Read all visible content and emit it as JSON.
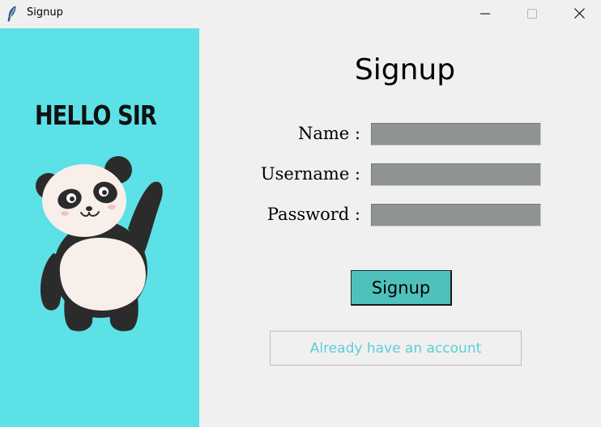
{
  "window": {
    "title": "Signup",
    "icon": "feather-icon"
  },
  "left_panel": {
    "greeting": "HELLO SIR",
    "background": "#5ce1e6",
    "illustration": "panda-waving"
  },
  "form": {
    "heading": "Signup",
    "fields": [
      {
        "label": "Name :",
        "value": "",
        "placeholder": ""
      },
      {
        "label": "Username :",
        "value": "",
        "placeholder": ""
      },
      {
        "label": "Password :",
        "value": "",
        "placeholder": ""
      }
    ],
    "submit_label": "Signup",
    "login_link_label": "Already have an account"
  },
  "colors": {
    "accent_button": "#4fc1bc",
    "entry_fill": "#8f9393",
    "link_text": "#5ccfd4"
  }
}
